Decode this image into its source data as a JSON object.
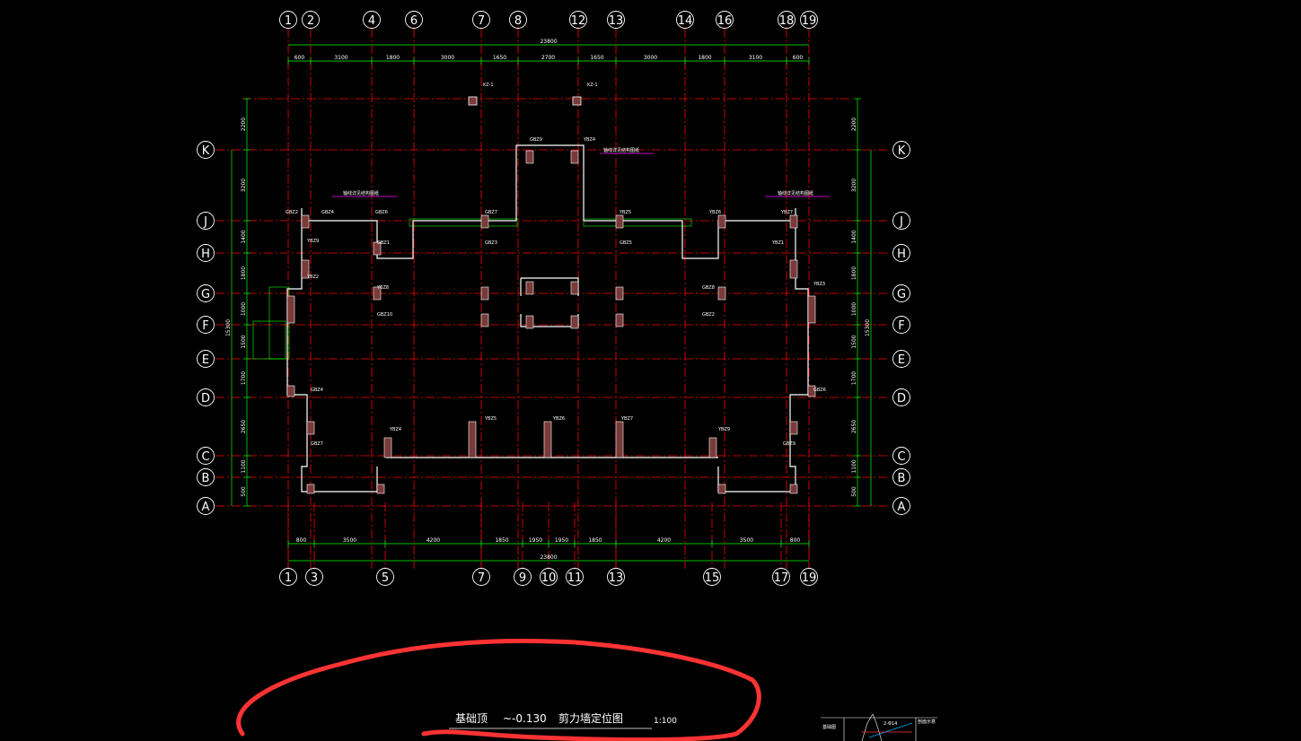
{
  "drawing": {
    "title_prefix": "基础顶",
    "title_elevation": "~-0.130",
    "title_name": "剪力墙定位图",
    "scale": "1:100",
    "top_total": "23800",
    "bottom_total": "23800",
    "left_total": "15300",
    "right_total": "15300",
    "top_axes": [
      "1",
      "2",
      "4",
      "6",
      "7",
      "8",
      "12",
      "13",
      "14",
      "16",
      "18",
      "19"
    ],
    "bottom_axes": [
      "1",
      "3",
      "5",
      "7",
      "9",
      "10",
      "11",
      "13",
      "15",
      "17",
      "19"
    ],
    "row_axes": [
      "K",
      "J",
      "H",
      "G",
      "F",
      "E",
      "D",
      "C",
      "B",
      "A"
    ],
    "top_dims": [
      "600",
      "3100",
      "1800",
      "3000",
      "1650",
      "2700",
      "1650",
      "3000",
      "1800",
      "3100",
      "600"
    ],
    "bottom_dims": [
      "800",
      "3500",
      "4200",
      "1850",
      "1950",
      "1950",
      "1850",
      "4200",
      "3500",
      "800"
    ],
    "side_dims": [
      "2200",
      "3200",
      "1400",
      "1800",
      "1000",
      "1500",
      "1700",
      "2650",
      "1100",
      "500"
    ],
    "column_tags": [
      "KZ-1",
      "KZ-1"
    ],
    "note_labels": [
      "轴线详见结构图纸",
      "轴线详见结构图纸",
      "轴线详见结构图纸"
    ],
    "wall_tags": [
      "GBZ2",
      "GBZ4",
      "GBZ6",
      "GBZ7",
      "GBZ9",
      "YBZ4",
      "YBZ5",
      "YBZ6",
      "YBZ7",
      "YBZ9",
      "GBZ1",
      "GBZ3",
      "GBZ5",
      "YBZ1",
      "YBZ2",
      "YBZ3",
      "YBZ8",
      "GBZ8",
      "GBZ10"
    ],
    "inset": {
      "label": "基础图",
      "label2": "剖面示意",
      "note": "2-Φ14"
    }
  },
  "colors": {
    "axis_line": "#ff0000",
    "dim_line": "#00ff00",
    "wall": "#ffffff",
    "wall_fill": "#7a3a3a",
    "note": "#ff00ff",
    "highlight": "#ff3333"
  }
}
